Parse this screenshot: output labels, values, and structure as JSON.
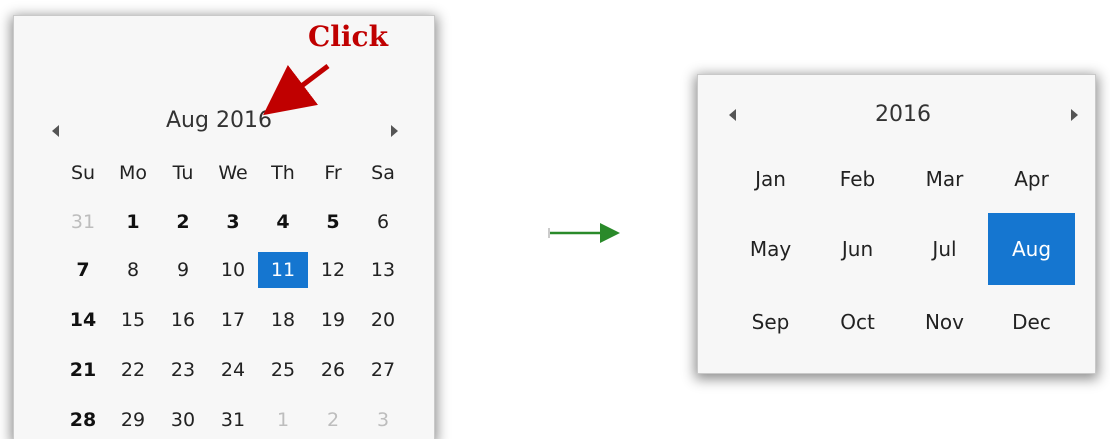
{
  "day_view": {
    "header_title": "Aug 2016",
    "weekdays": [
      "Su",
      "Mo",
      "Tu",
      "We",
      "Th",
      "Fr",
      "Sa"
    ],
    "weeks": [
      [
        {
          "t": "31",
          "s": "muted"
        },
        {
          "t": "1",
          "s": "bold"
        },
        {
          "t": "2",
          "s": "bold"
        },
        {
          "t": "3",
          "s": "bold"
        },
        {
          "t": "4",
          "s": "bold"
        },
        {
          "t": "5",
          "s": "bold"
        },
        {
          "t": "6",
          "s": ""
        }
      ],
      [
        {
          "t": "7",
          "s": "bold"
        },
        {
          "t": "8",
          "s": ""
        },
        {
          "t": "9",
          "s": ""
        },
        {
          "t": "10",
          "s": ""
        },
        {
          "t": "11",
          "s": "selected"
        },
        {
          "t": "12",
          "s": ""
        },
        {
          "t": "13",
          "s": ""
        }
      ],
      [
        {
          "t": "14",
          "s": "bold"
        },
        {
          "t": "15",
          "s": ""
        },
        {
          "t": "16",
          "s": ""
        },
        {
          "t": "17",
          "s": ""
        },
        {
          "t": "18",
          "s": ""
        },
        {
          "t": "19",
          "s": ""
        },
        {
          "t": "20",
          "s": ""
        }
      ],
      [
        {
          "t": "21",
          "s": "bold"
        },
        {
          "t": "22",
          "s": ""
        },
        {
          "t": "23",
          "s": ""
        },
        {
          "t": "24",
          "s": ""
        },
        {
          "t": "25",
          "s": ""
        },
        {
          "t": "26",
          "s": ""
        },
        {
          "t": "27",
          "s": ""
        }
      ],
      [
        {
          "t": "28",
          "s": "bold"
        },
        {
          "t": "29",
          "s": ""
        },
        {
          "t": "30",
          "s": ""
        },
        {
          "t": "31",
          "s": ""
        },
        {
          "t": "1",
          "s": "muted"
        },
        {
          "t": "2",
          "s": "muted"
        },
        {
          "t": "3",
          "s": "muted"
        }
      ]
    ]
  },
  "month_view": {
    "header_title": "2016",
    "months": [
      "Jan",
      "Feb",
      "Mar",
      "Apr",
      "May",
      "Jun",
      "Jul",
      "Aug",
      "Sep",
      "Oct",
      "Nov",
      "Dec"
    ],
    "selected_month": "Aug"
  },
  "annotation": {
    "click_label": "Click",
    "click_color": "#c00000",
    "transition_arrow_color": "#2a8a2a"
  },
  "colors": {
    "selection": "#1576d0"
  }
}
